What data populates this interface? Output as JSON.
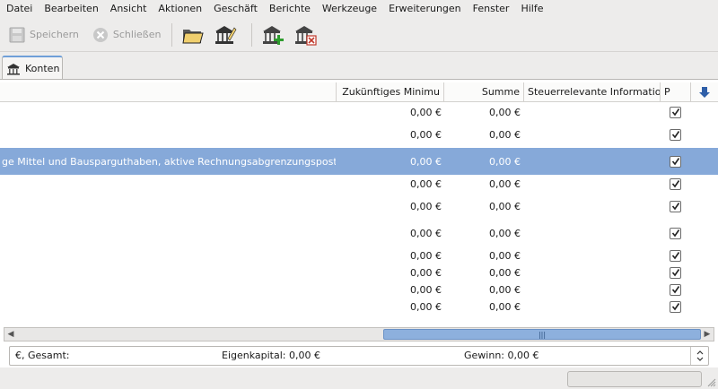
{
  "menubar": [
    "Datei",
    "Bearbeiten",
    "Ansicht",
    "Aktionen",
    "Geschäft",
    "Berichte",
    "Werkzeuge",
    "Erweiterungen",
    "Fenster",
    "Hilfe"
  ],
  "toolbar": {
    "save_label": "Speichern",
    "close_label": "Schließen"
  },
  "tab": {
    "label": "Konten"
  },
  "table": {
    "columns": {
      "future_min": "Zukünftiges Minimu",
      "total": "Summe",
      "tax_info": "Steuerrelevante Informatio",
      "placeholder": "P"
    },
    "rows": [
      {
        "name": "",
        "future_min": "0,00 €",
        "total": "0,00 €",
        "checked": true,
        "selected": false
      },
      {
        "name": "",
        "future_min": "0,00 €",
        "total": "0,00 €",
        "checked": true,
        "selected": false
      },
      {
        "name": "ge Mittel und Bausparguthaben, aktive Rechnungsabgrenzungsposten",
        "future_min": "0,00 €",
        "total": "0,00 €",
        "checked": true,
        "selected": true
      },
      {
        "name": "",
        "future_min": "0,00 €",
        "total": "0,00 €",
        "checked": true,
        "selected": false
      },
      {
        "name": "",
        "future_min": "0,00 €",
        "total": "0,00 €",
        "checked": true,
        "selected": false
      },
      {
        "name": "",
        "future_min": "0,00 €",
        "total": "0,00 €",
        "checked": true,
        "selected": false
      },
      {
        "name": "",
        "future_min": "0,00 €",
        "total": "0,00 €",
        "checked": true,
        "selected": false
      },
      {
        "name": "",
        "future_min": "0,00 €",
        "total": "0,00 €",
        "checked": true,
        "selected": false
      },
      {
        "name": "",
        "future_min": "0,00 €",
        "total": "0,00 €",
        "checked": true,
        "selected": false
      },
      {
        "name": "",
        "future_min": "0,00 €",
        "total": "0,00 €",
        "checked": true,
        "selected": false
      }
    ]
  },
  "summary": {
    "total_label": "€, Gesamt:",
    "equity": "Eigenkapital: 0,00 €",
    "profit": "Gewinn: 0,00 €"
  },
  "colors": {
    "selection": "#86a9d9",
    "accent": "#2f5fa8"
  }
}
